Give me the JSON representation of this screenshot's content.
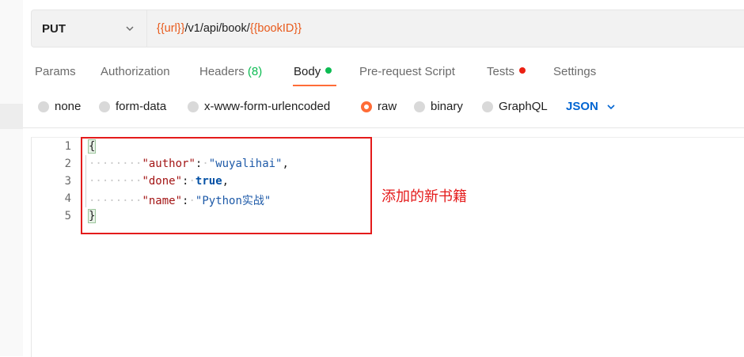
{
  "request": {
    "method": "PUT",
    "url_parts": [
      {
        "text": "{{url}}",
        "var": true
      },
      {
        "text": "/v1/api/book/",
        "var": false
      },
      {
        "text": "{{bookID}}",
        "var": true
      }
    ]
  },
  "tabs": [
    {
      "label": "Params"
    },
    {
      "label": "Authorization"
    },
    {
      "label": "Headers",
      "count": "(8)"
    },
    {
      "label": "Body",
      "dot": "green",
      "active": true
    },
    {
      "label": "Pre-request Script"
    },
    {
      "label": "Tests",
      "dot": "red"
    },
    {
      "label": "Settings"
    }
  ],
  "body_types": [
    {
      "label": "none",
      "selected": false
    },
    {
      "label": "form-data",
      "selected": false
    },
    {
      "label": "x-www-form-urlencoded",
      "selected": false
    },
    {
      "label": "raw",
      "selected": true
    },
    {
      "label": "binary",
      "selected": false
    },
    {
      "label": "GraphQL",
      "selected": false
    }
  ],
  "format_select": "JSON",
  "editor": {
    "line_numbers": [
      "1",
      "2",
      "3",
      "4",
      "5"
    ],
    "lines": [
      {
        "key": "author",
        "value": "\"wuyalihai\"",
        "type": "string",
        "comma": true
      },
      {
        "key": "done",
        "value": "true",
        "type": "keyword",
        "comma": true
      },
      {
        "key": "name",
        "value": "\"Python实战\"",
        "type": "string",
        "comma": false
      }
    ]
  },
  "annotation": "添加的新书籍",
  "colors": {
    "accent": "#ff6c37",
    "variable": "#e8591a",
    "annotation": "#e41b1b",
    "json_select": "#0265d2"
  }
}
